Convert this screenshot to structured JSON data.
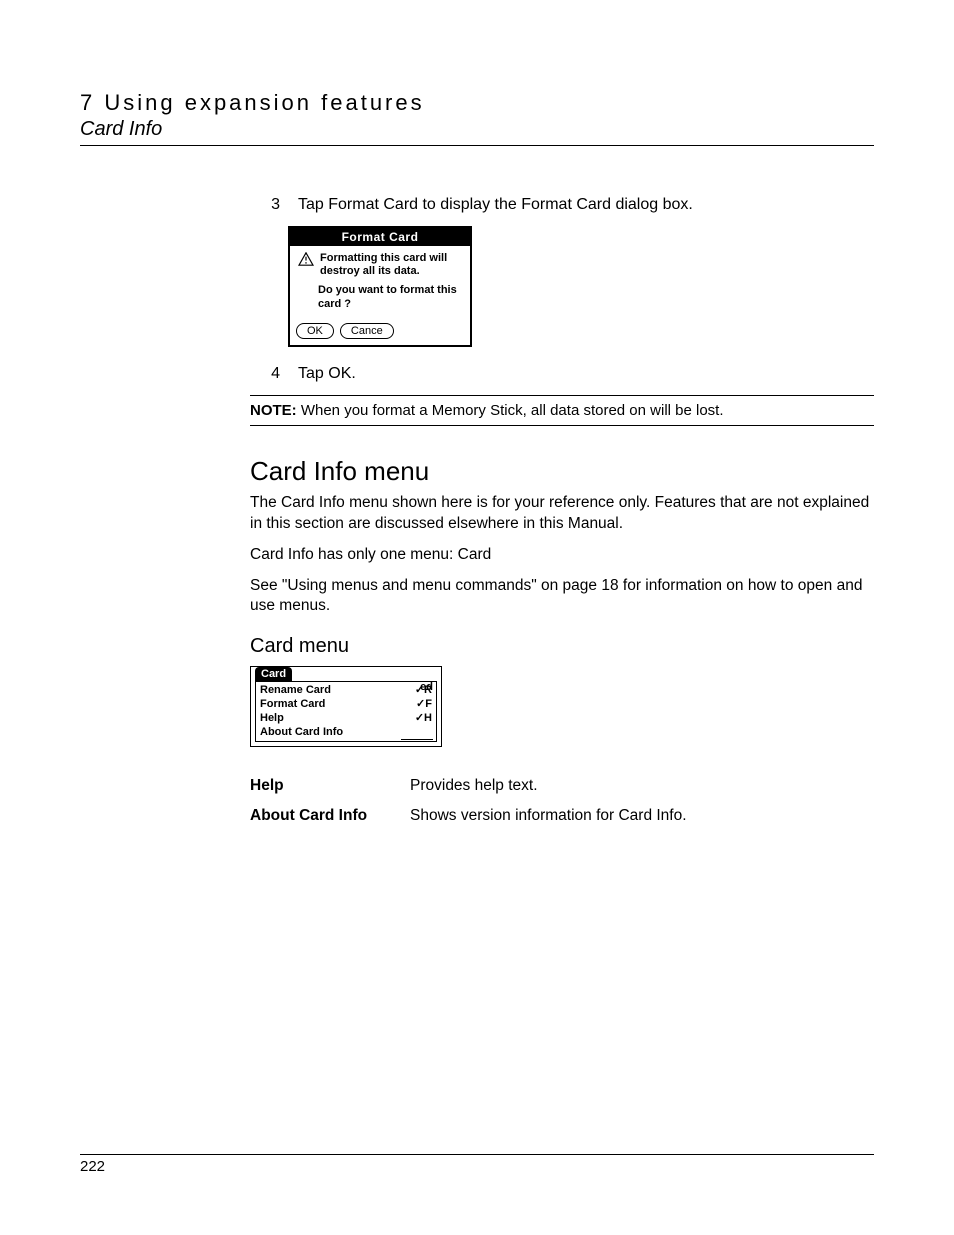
{
  "header": {
    "chapter": "7 Using expansion features",
    "section": "Card Info"
  },
  "steps": [
    {
      "num": "3",
      "text": "Tap Format Card to display the Format Card dialog box."
    },
    {
      "num": "4",
      "text": "Tap OK."
    }
  ],
  "dialog": {
    "title": "Format Card",
    "warn1": "Formatting this card will destroy all its data.",
    "warn2": "Do you want to format this card ?",
    "ok": "OK",
    "cancel": "Cance"
  },
  "note": {
    "label": "NOTE:",
    "text": "When you format a Memory Stick, all data stored on will be lost."
  },
  "h2": "Card Info menu",
  "para1": "The Card Info menu shown here is for your reference only. Features that are not explained in this section are discussed elsewhere in this Manual.",
  "para2": "Card Info has only one menu: Card",
  "para3": "See \"Using menus and menu commands\" on page 18 for information on how to open and use menus.",
  "h3": "Card menu",
  "menu": {
    "tab": "Card",
    "items": [
      {
        "label": "Rename Card",
        "shortcut": "R"
      },
      {
        "label": "Format Card",
        "shortcut": "F"
      },
      {
        "label": "Help",
        "shortcut": "H"
      },
      {
        "label": "About Card Info",
        "shortcut": ""
      }
    ],
    "suffix": "ed"
  },
  "defs": [
    {
      "term": "Help",
      "desc": "Provides help text."
    },
    {
      "term": "About Card Info",
      "desc": "Shows version information for Card Info."
    }
  ],
  "page_number": "222"
}
